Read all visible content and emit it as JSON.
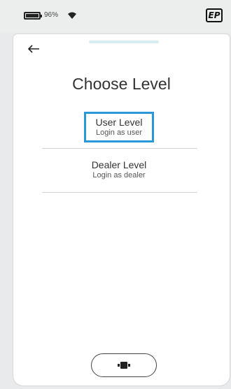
{
  "status_bar": {
    "battery_percent": "96%",
    "battery_icon": "battery-icon",
    "wifi_icon": "wifi-icon",
    "logo_text": "EP"
  },
  "header": {
    "back_icon": "arrow-left-icon",
    "title": "Choose Level"
  },
  "options": [
    {
      "title": "User Level",
      "subtitle": "Login as user",
      "selected": true
    },
    {
      "title": "Dealer Level",
      "subtitle": "Login as dealer",
      "selected": false
    }
  ],
  "home": {
    "icon": "home-indicator-icon"
  },
  "colors": {
    "selection_border": "#2a97d8",
    "background": "#e9eaec",
    "screen": "#ffffff"
  }
}
